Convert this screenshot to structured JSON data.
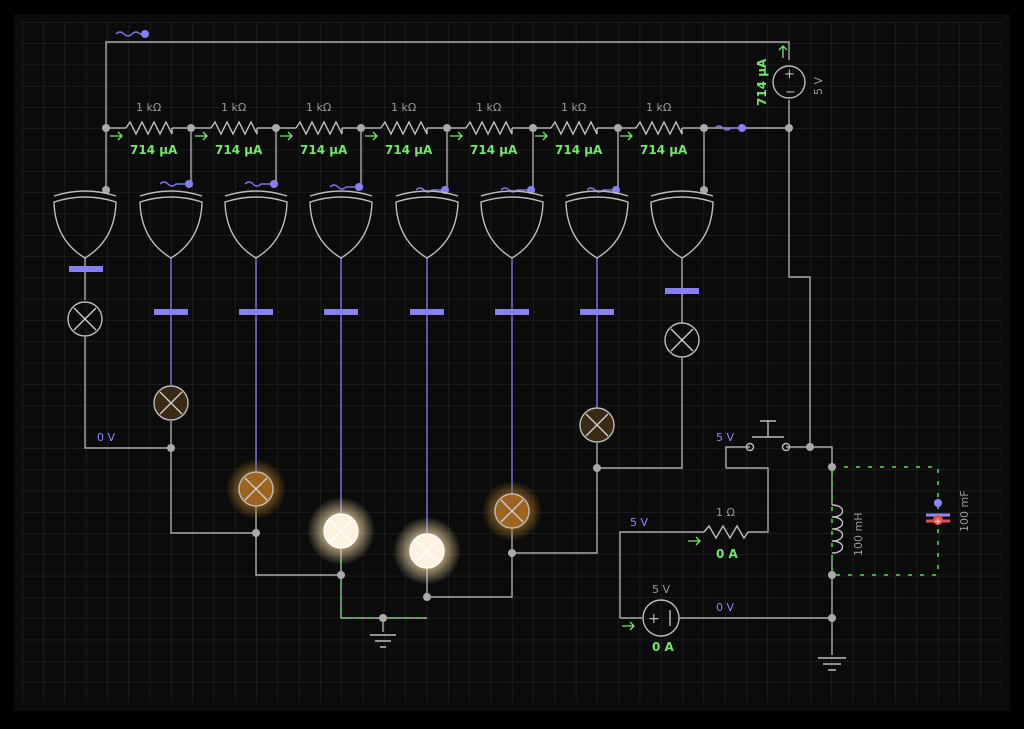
{
  "colors": {
    "background": "#000000",
    "panel": "#0b0b0b",
    "grid": "#2a2a2a",
    "wire": "#a9a9a9",
    "current_label": "#74e86a",
    "voltage_label": "#8d88ff",
    "logic_high": "#7b74e6",
    "lamp_dim": "#c98a2a",
    "lamp_bright": "#fff1d6"
  },
  "resistor_ladder": {
    "resistance_labels": [
      "1 kΩ",
      "1 kΩ",
      "1 kΩ",
      "1 kΩ",
      "1 kΩ",
      "1 kΩ",
      "1 kΩ"
    ],
    "current_labels": [
      "714 µA",
      "714 µA",
      "714 µA",
      "714 µA",
      "714 µA",
      "714 µA",
      "714 µA"
    ]
  },
  "top_source": {
    "current": "714 µA",
    "voltage": "5 V"
  },
  "labels": {
    "left_node_voltage": "0 V",
    "switch_node_voltage": "5 V",
    "resistor_node_voltage": "5 V",
    "ground_node_voltage": "0 V"
  },
  "small_resistor": {
    "resistance": "1 Ω",
    "current": "0 A"
  },
  "bottom_source": {
    "voltage": "5 V",
    "current": "0 A"
  },
  "inductor": {
    "value": "100 mH"
  },
  "capacitor": {
    "value": "100 mF"
  },
  "gates": {
    "count": 8,
    "type": "xnor-icon"
  },
  "lamps": {
    "brightness": [
      0,
      0.35,
      0.7,
      1.0,
      1.0,
      0.7,
      0.35,
      0
    ]
  }
}
